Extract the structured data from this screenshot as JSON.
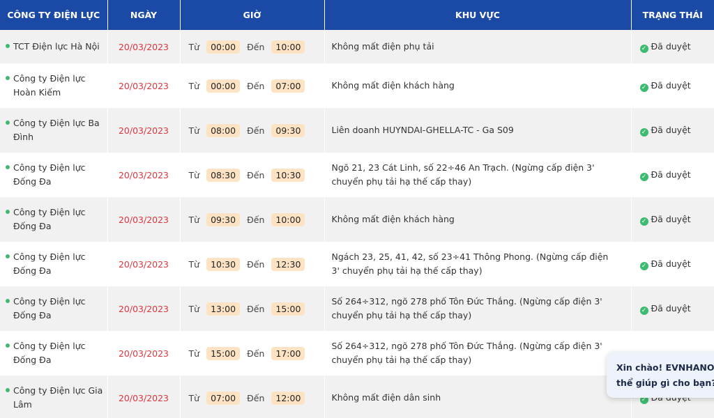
{
  "header": {
    "company": "CÔNG TY ĐIỆN LỰC",
    "date": "NGÀY",
    "time": "GIỜ",
    "area": "KHU VỰC",
    "status": "TRẠNG THÁI"
  },
  "labels": {
    "from": "Từ",
    "to": "Đến"
  },
  "rows": [
    {
      "company": "TCT Điện lực Hà Nội",
      "date": "20/03/2023",
      "start": "00:00",
      "end": "10:00",
      "area": "Không mất điện phụ tải",
      "status": "Đã duyệt"
    },
    {
      "company": "Công ty Điện lực Hoàn Kiếm",
      "date": "20/03/2023",
      "start": "00:00",
      "end": "07:00",
      "area": "Không mất điện khách hàng",
      "status": "Đã duyệt"
    },
    {
      "company": "Công ty Điện lực Ba Đình",
      "date": "20/03/2023",
      "start": "08:00",
      "end": "09:30",
      "area": "Liên doanh HUYNDAI-GHELLA-TC - Ga S09",
      "status": "Đã duyệt"
    },
    {
      "company": "Công ty Điện lực Đống Đa",
      "date": "20/03/2023",
      "start": "08:30",
      "end": "10:30",
      "area": "Ngõ 21, 23 Cát Linh, số 22÷46 An Trạch. (Ngừng cấp điện 3' chuyển phụ tải hạ thế cấp thay)",
      "status": "Đã duyệt"
    },
    {
      "company": "Công ty Điện lực Đống Đa",
      "date": "20/03/2023",
      "start": "09:30",
      "end": "10:00",
      "area": "Không mất điện khách hàng",
      "status": "Đã duyệt"
    },
    {
      "company": "Công ty Điện lực Đống Đa",
      "date": "20/03/2023",
      "start": "10:30",
      "end": "12:30",
      "area": "Ngách 23, 25, 41, 42, số 23÷41 Thông Phong. (Ngừng cấp điện 3' chuyển phụ tải hạ thế cấp thay)",
      "status": "Đã duyệt"
    },
    {
      "company": "Công ty Điện lực Đống Đa",
      "date": "20/03/2023",
      "start": "13:00",
      "end": "15:00",
      "area": "Số 264÷312, ngõ 278 phố Tôn Đức Thắng. (Ngừng cấp điện 3' chuyển phụ tải hạ thế cấp thay)",
      "status": "Đã duyệt"
    },
    {
      "company": "Công ty Điện lực Đống Đa",
      "date": "20/03/2023",
      "start": "15:00",
      "end": "17:00",
      "area": "Số 264÷312, ngõ 278 phố Tôn Đức Thắng. (Ngừng cấp điện 3' chuyển phụ tải hạ thế cấp thay)",
      "status": ""
    },
    {
      "company": "Công ty Điện lực Gia Lâm",
      "date": "20/03/2023",
      "start": "07:00",
      "end": "12:00",
      "area": "Không mất điện dân sinh",
      "status": "Đã duyệt"
    }
  ],
  "chat": {
    "line1": "Xin chào! EVNHANOI c",
    "line2": "thể giúp gì cho bạn?"
  },
  "colors": {
    "header_bg": "#1a4aa6",
    "date_red": "#e0353e",
    "status_green": "#3dbb6e",
    "time_pill": "#fde3c4"
  }
}
